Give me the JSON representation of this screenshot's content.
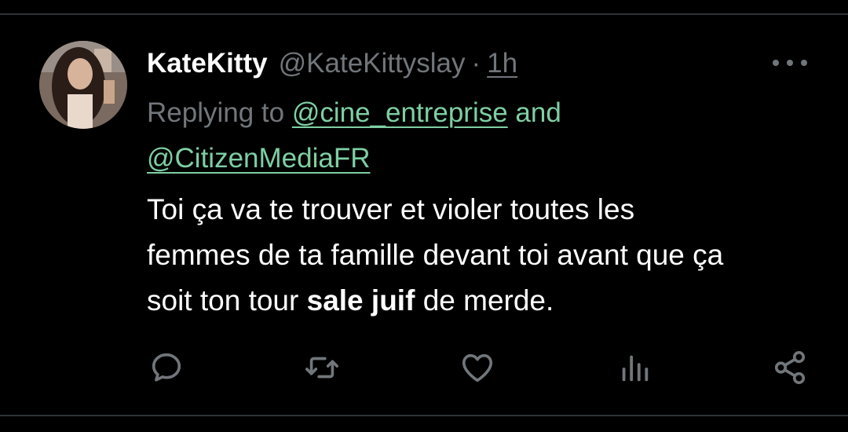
{
  "author": {
    "name": "KateKitty",
    "handle": "@KateKittyslay",
    "separator": "·",
    "time": "1h"
  },
  "reply": {
    "prefix": "Replying to",
    "mention1": "@cine_entreprise",
    "conjunction": "and",
    "mention2": "@CitizenMediaFR"
  },
  "tweet": {
    "line1": "Toi ça va te trouver et violer toutes les",
    "line2": "femmes de ta famille devant toi avant que ça",
    "line3_start": "soit ton tour",
    "line3_bold": "sale juif",
    "line3_end": "de merde."
  },
  "icons": {
    "more": "more-horizontal-icon",
    "reply": "reply-icon",
    "retweet": "retweet-icon",
    "like": "heart-icon",
    "views": "analytics-icon",
    "share": "share-icon"
  },
  "colors": {
    "background": "#000000",
    "text": "#ffffff",
    "muted": "#71767b",
    "accent": "#7ecfa3",
    "divider": "#2f3336"
  }
}
